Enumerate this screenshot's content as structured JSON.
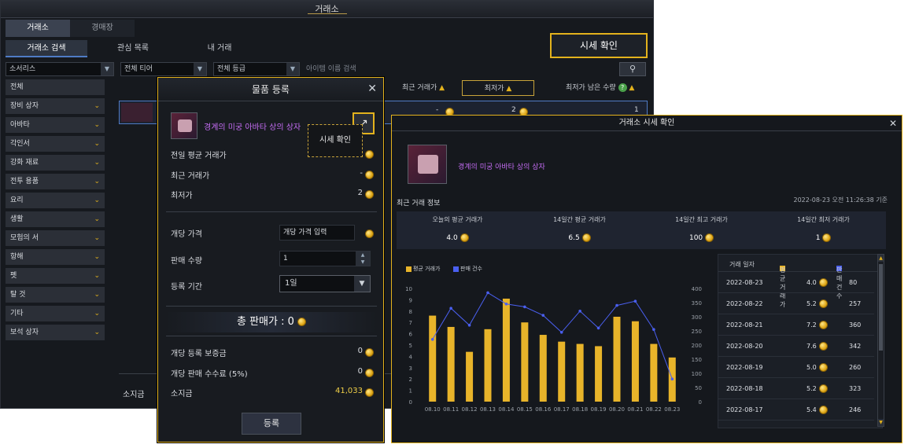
{
  "exchange": {
    "title": "거래소",
    "top_tabs": [
      "거래소",
      "경매장"
    ],
    "sub_tabs": [
      "거래소 검색",
      "관심 목록",
      "내 거래"
    ],
    "price_check_button": "시세 확인",
    "filters": {
      "category": "소서리스",
      "tier": "전체 티어",
      "grade": "전체 등급",
      "search_placeholder": "아이템 이름 검색"
    },
    "categories": [
      "전체",
      "장비 상자",
      "아바타",
      "각인서",
      "강화 재료",
      "전투 용품",
      "요리",
      "생활",
      "모험의 서",
      "항해",
      "펫",
      "탈 것",
      "기타",
      "보석 상자"
    ],
    "columns": {
      "recent": "최근 거래가",
      "lowest": "최저가",
      "remaining": "최저가 남은 수량"
    },
    "row": {
      "recent": "-",
      "lowest": "2",
      "remaining": "1"
    },
    "gold_label": "소지금"
  },
  "register": {
    "title": "물품 등록",
    "item_name": "경계의 미궁 아바타 상의 상자",
    "tooltip": "시세 확인",
    "prev_avg_label": "전일 평균 거래가",
    "recent_label": "최근 거래가",
    "recent_value": "-",
    "lowest_label": "최저가",
    "lowest_value": "2",
    "unit_price_label": "개당 가격",
    "unit_price_placeholder": "개당 가격 입력",
    "qty_label": "판매 수량",
    "qty_value": "1",
    "period_label": "등록 기간",
    "period_value": "1일",
    "total_label": "총 판매가 : 0",
    "deposit_label": "개당 등록 보증금",
    "deposit_value": "0",
    "fee_label": "개당 판매 수수료 (5%)",
    "fee_value": "0",
    "gold_label": "소지금",
    "gold_value": "41,033",
    "register_button": "등록"
  },
  "price_window": {
    "title": "거래소 시세 확인",
    "item_name": "경계의 미궁 아바타 상의 상자",
    "section_label": "최근 거래 정보",
    "timestamp": "2022-08-23 오전 11:26:38 기준",
    "stats": [
      {
        "label": "오늘의 평균 거래가",
        "value": "4.0"
      },
      {
        "label": "14일간 평균 거래가",
        "value": "6.5"
      },
      {
        "label": "14일간 최고 거래가",
        "value": "100"
      },
      {
        "label": "14일간 최저 거래가",
        "value": "1"
      }
    ],
    "table": {
      "headers": [
        "거래 일자",
        "평균 거래가",
        "판매 건수"
      ],
      "rows": [
        [
          "2022-08-23",
          "4.0",
          "80"
        ],
        [
          "2022-08-22",
          "5.2",
          "257"
        ],
        [
          "2022-08-21",
          "7.2",
          "360"
        ],
        [
          "2022-08-20",
          "7.6",
          "342"
        ],
        [
          "2022-08-19",
          "5.0",
          "260"
        ],
        [
          "2022-08-18",
          "5.2",
          "323"
        ],
        [
          "2022-08-17",
          "5.4",
          "246"
        ]
      ]
    }
  },
  "colors": {
    "accent": "#e3b21d",
    "bar": "#e8b42a",
    "line": "#4a5ff0",
    "item_name": "#c36cf2"
  },
  "chart_data": {
    "type": "bar",
    "categories": [
      "08.10",
      "08.11",
      "08.12",
      "08.13",
      "08.14",
      "08.15",
      "08.16",
      "08.17",
      "08.18",
      "08.19",
      "08.20",
      "08.21",
      "08.22",
      "08.23"
    ],
    "series": [
      {
        "name": "평균 거래가",
        "type": "bar",
        "axis": "left",
        "values": [
          7.6,
          6.6,
          4.4,
          6.4,
          9.1,
          7.0,
          5.9,
          5.3,
          5.1,
          4.9,
          7.5,
          7.1,
          5.1,
          3.9
        ]
      },
      {
        "name": "판매 건수",
        "type": "line",
        "axis": "right",
        "values": [
          220,
          330,
          270,
          385,
          345,
          335,
          305,
          245,
          320,
          260,
          340,
          355,
          255,
          80
        ]
      }
    ],
    "y_left": {
      "ticks": [
        "0",
        "1",
        "2",
        "3",
        "4",
        "5",
        "6",
        "7",
        "8",
        "9",
        "10"
      ],
      "ylim": [
        0,
        10
      ]
    },
    "y_right": {
      "ticks": [
        "0",
        "50",
        "100",
        "150",
        "200",
        "250",
        "300",
        "350",
        "400"
      ],
      "ylim": [
        0,
        400
      ]
    },
    "legend_position": "top-left",
    "grid": false
  }
}
